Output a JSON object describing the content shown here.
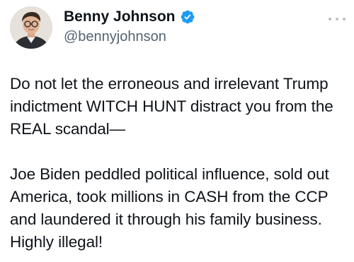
{
  "author": {
    "display_name": "Benny Johnson",
    "handle": "@bennyjohnson",
    "verified": true
  },
  "icons": {
    "verified": "verified-badge-icon",
    "more": "more-options-icon",
    "avatar": "profile-photo"
  },
  "colors": {
    "verified_blue": "#1d9bf0",
    "text_primary": "#0f1419",
    "text_secondary": "#536471"
  },
  "tweet": {
    "paragraphs": [
      "Do not let the erroneous and irrelevant Trump indictment WITCH HUNT distract you from the REAL scandal—",
      "Joe Biden peddled political influence, sold out America, took millions in CASH from the CCP and laundered it through his family business. Highly illegal!"
    ]
  }
}
